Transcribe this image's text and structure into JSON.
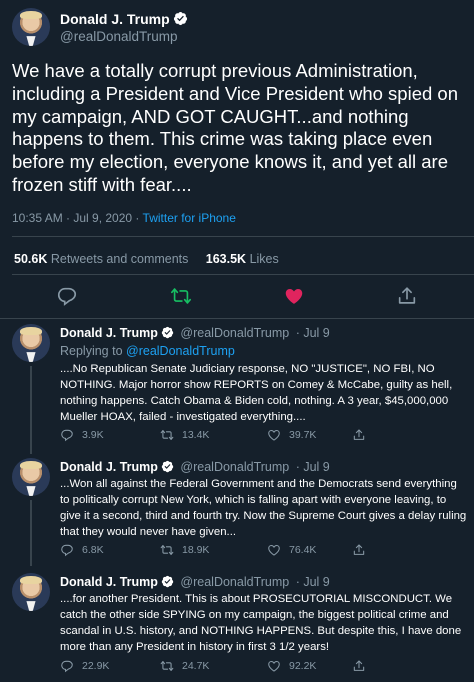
{
  "main": {
    "name": "Donald J. Trump",
    "handle": "@realDonaldTrump",
    "text": "We have a totally corrupt previous Administration, including a President and Vice President who spied on my campaign, AND GOT CAUGHT...and nothing happens to them. This crime was taking place even before my election, everyone knows it, and yet all are frozen stiff with fear....",
    "time": "10:35 AM · Jul 9, 2020 · ",
    "source": "Twitter for iPhone",
    "retweets_count": "50.6K",
    "retweets_label": "Retweets and comments",
    "likes_count": "163.5K",
    "likes_label": "Likes",
    "icons": [
      "reply-icon",
      "retweet-icon",
      "like-icon",
      "share-icon"
    ],
    "colors": {
      "retweet": "#17bf63",
      "like": "#e0245e",
      "link": "#1da1f2"
    }
  },
  "replies": [
    {
      "name": "Donald J. Trump",
      "handle": "@realDonaldTrump",
      "date": "· Jul 9",
      "replying_label": "Replying to ",
      "replying_to": "@realDonaldTrump",
      "text": "....No Republican Senate Judiciary response, NO \"JUSTICE\", NO FBI, NO NOTHING. Major horror show REPORTS on Comey & McCabe, guilty as hell, nothing happens. Catch Obama & Biden cold, nothing. A 3 year, $45,000,000 Mueller HOAX, failed - investigated everything....",
      "replies": "3.9K",
      "retweets": "13.4K",
      "likes": "39.7K"
    },
    {
      "name": "Donald J. Trump",
      "handle": "@realDonaldTrump",
      "date": "· Jul 9",
      "text": "...Won all against the Federal Government and the Democrats send everything to politically corrupt New York, which is falling apart with everyone leaving, to give it a second, third and fourth try. Now the Supreme Court gives a delay ruling that they would never have given...",
      "replies": "6.8K",
      "retweets": "18.9K",
      "likes": "76.4K"
    },
    {
      "name": "Donald J. Trump",
      "handle": "@realDonaldTrump",
      "date": "· Jul 9",
      "text": "....for another President. This is about PROSECUTORIAL MISCONDUCT. We catch the other side SPYING on my campaign, the biggest political crime and scandal in U.S. history, and NOTHING HAPPENS. But despite this, I have done more than any President in history in first 3 1/2 years!",
      "replies": "22.9K",
      "retweets": "24.7K",
      "likes": "92.2K"
    }
  ]
}
